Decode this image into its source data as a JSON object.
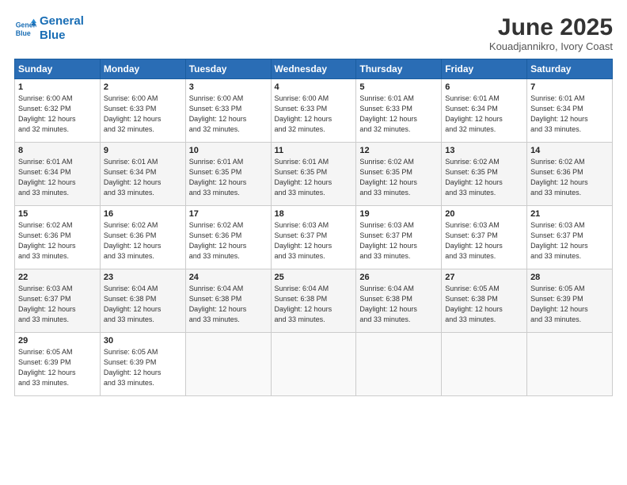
{
  "header": {
    "logo_line1": "General",
    "logo_line2": "Blue",
    "title": "June 2025",
    "location": "Kouadjannikro, Ivory Coast"
  },
  "days_of_week": [
    "Sunday",
    "Monday",
    "Tuesday",
    "Wednesday",
    "Thursday",
    "Friday",
    "Saturday"
  ],
  "weeks": [
    [
      {
        "day": "1",
        "text": "Sunrise: 6:00 AM\nSunset: 6:32 PM\nDaylight: 12 hours\nand 32 minutes."
      },
      {
        "day": "2",
        "text": "Sunrise: 6:00 AM\nSunset: 6:33 PM\nDaylight: 12 hours\nand 32 minutes."
      },
      {
        "day": "3",
        "text": "Sunrise: 6:00 AM\nSunset: 6:33 PM\nDaylight: 12 hours\nand 32 minutes."
      },
      {
        "day": "4",
        "text": "Sunrise: 6:00 AM\nSunset: 6:33 PM\nDaylight: 12 hours\nand 32 minutes."
      },
      {
        "day": "5",
        "text": "Sunrise: 6:01 AM\nSunset: 6:33 PM\nDaylight: 12 hours\nand 32 minutes."
      },
      {
        "day": "6",
        "text": "Sunrise: 6:01 AM\nSunset: 6:34 PM\nDaylight: 12 hours\nand 32 minutes."
      },
      {
        "day": "7",
        "text": "Sunrise: 6:01 AM\nSunset: 6:34 PM\nDaylight: 12 hours\nand 33 minutes."
      }
    ],
    [
      {
        "day": "8",
        "text": "Sunrise: 6:01 AM\nSunset: 6:34 PM\nDaylight: 12 hours\nand 33 minutes."
      },
      {
        "day": "9",
        "text": "Sunrise: 6:01 AM\nSunset: 6:34 PM\nDaylight: 12 hours\nand 33 minutes."
      },
      {
        "day": "10",
        "text": "Sunrise: 6:01 AM\nSunset: 6:35 PM\nDaylight: 12 hours\nand 33 minutes."
      },
      {
        "day": "11",
        "text": "Sunrise: 6:01 AM\nSunset: 6:35 PM\nDaylight: 12 hours\nand 33 minutes."
      },
      {
        "day": "12",
        "text": "Sunrise: 6:02 AM\nSunset: 6:35 PM\nDaylight: 12 hours\nand 33 minutes."
      },
      {
        "day": "13",
        "text": "Sunrise: 6:02 AM\nSunset: 6:35 PM\nDaylight: 12 hours\nand 33 minutes."
      },
      {
        "day": "14",
        "text": "Sunrise: 6:02 AM\nSunset: 6:36 PM\nDaylight: 12 hours\nand 33 minutes."
      }
    ],
    [
      {
        "day": "15",
        "text": "Sunrise: 6:02 AM\nSunset: 6:36 PM\nDaylight: 12 hours\nand 33 minutes."
      },
      {
        "day": "16",
        "text": "Sunrise: 6:02 AM\nSunset: 6:36 PM\nDaylight: 12 hours\nand 33 minutes."
      },
      {
        "day": "17",
        "text": "Sunrise: 6:02 AM\nSunset: 6:36 PM\nDaylight: 12 hours\nand 33 minutes."
      },
      {
        "day": "18",
        "text": "Sunrise: 6:03 AM\nSunset: 6:37 PM\nDaylight: 12 hours\nand 33 minutes."
      },
      {
        "day": "19",
        "text": "Sunrise: 6:03 AM\nSunset: 6:37 PM\nDaylight: 12 hours\nand 33 minutes."
      },
      {
        "day": "20",
        "text": "Sunrise: 6:03 AM\nSunset: 6:37 PM\nDaylight: 12 hours\nand 33 minutes."
      },
      {
        "day": "21",
        "text": "Sunrise: 6:03 AM\nSunset: 6:37 PM\nDaylight: 12 hours\nand 33 minutes."
      }
    ],
    [
      {
        "day": "22",
        "text": "Sunrise: 6:03 AM\nSunset: 6:37 PM\nDaylight: 12 hours\nand 33 minutes."
      },
      {
        "day": "23",
        "text": "Sunrise: 6:04 AM\nSunset: 6:38 PM\nDaylight: 12 hours\nand 33 minutes."
      },
      {
        "day": "24",
        "text": "Sunrise: 6:04 AM\nSunset: 6:38 PM\nDaylight: 12 hours\nand 33 minutes."
      },
      {
        "day": "25",
        "text": "Sunrise: 6:04 AM\nSunset: 6:38 PM\nDaylight: 12 hours\nand 33 minutes."
      },
      {
        "day": "26",
        "text": "Sunrise: 6:04 AM\nSunset: 6:38 PM\nDaylight: 12 hours\nand 33 minutes."
      },
      {
        "day": "27",
        "text": "Sunrise: 6:05 AM\nSunset: 6:38 PM\nDaylight: 12 hours\nand 33 minutes."
      },
      {
        "day": "28",
        "text": "Sunrise: 6:05 AM\nSunset: 6:39 PM\nDaylight: 12 hours\nand 33 minutes."
      }
    ],
    [
      {
        "day": "29",
        "text": "Sunrise: 6:05 AM\nSunset: 6:39 PM\nDaylight: 12 hours\nand 33 minutes."
      },
      {
        "day": "30",
        "text": "Sunrise: 6:05 AM\nSunset: 6:39 PM\nDaylight: 12 hours\nand 33 minutes."
      },
      {
        "day": "",
        "text": ""
      },
      {
        "day": "",
        "text": ""
      },
      {
        "day": "",
        "text": ""
      },
      {
        "day": "",
        "text": ""
      },
      {
        "day": "",
        "text": ""
      }
    ]
  ]
}
